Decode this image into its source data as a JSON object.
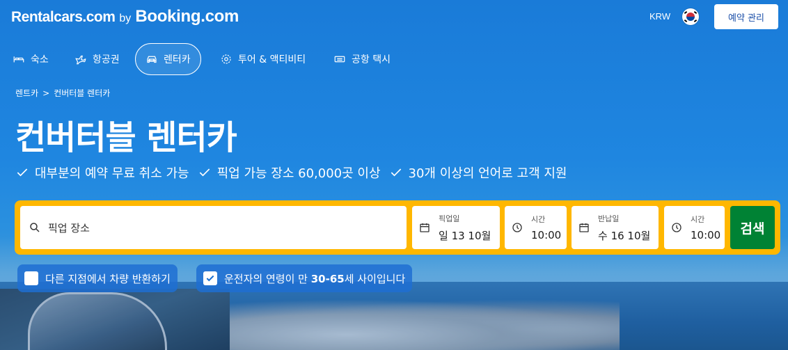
{
  "header": {
    "logo_rentalcars": "Rentalcars.com",
    "logo_by": "by",
    "logo_booking": "Booking.com",
    "currency": "KRW",
    "manage_booking": "예약 관리"
  },
  "nav": [
    {
      "label": "숙소",
      "icon": "bed-icon"
    },
    {
      "label": "항공권",
      "icon": "plane-icon"
    },
    {
      "label": "렌터카",
      "icon": "car-icon",
      "active": true
    },
    {
      "label": "투어 & 액티비티",
      "icon": "attractions-icon"
    },
    {
      "label": "공항 택시",
      "icon": "taxi-icon"
    }
  ],
  "breadcrumb": {
    "home": "렌트카",
    "separator": ">",
    "current": "컨버터블 렌터카"
  },
  "hero": {
    "title": "컨버터블 렌터카",
    "features": [
      "대부분의 예약 무료 취소 가능",
      "픽업 가능 장소 60,000곳 이상",
      "30개 이상의 언어로 고객 지원"
    ]
  },
  "search": {
    "location_placeholder": "픽업 장소",
    "pickup_date_label": "픽업일",
    "pickup_date_value": "일 13 10월",
    "pickup_time_label": "시간",
    "pickup_time_value": "10:00",
    "return_date_label": "반납일",
    "return_date_value": "수 16 10월",
    "return_time_label": "시간",
    "return_time_value": "10:00",
    "button": "검색"
  },
  "options": {
    "different_return": {
      "label": "다른 지점에서 차량 반환하기",
      "checked": false
    },
    "driver_age": {
      "label_pre": "운전자의 연령이 만 ",
      "label_bold": "30-65",
      "label_post": "세 사이입니다",
      "checked": true
    }
  },
  "colors": {
    "hero_blue": "#1a7bd8",
    "search_yellow": "#ffb700",
    "search_green": "#008234",
    "manage_text": "#1a4ea8"
  }
}
